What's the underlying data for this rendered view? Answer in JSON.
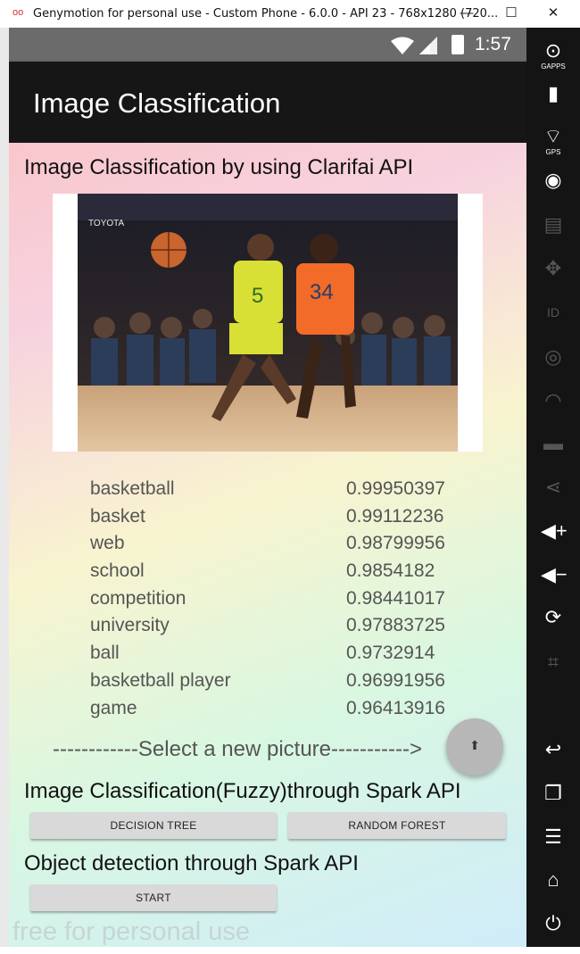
{
  "window": {
    "title": "Genymotion for personal use - Custom Phone - 6.0.0 - API 23 - 768x1280 (720..."
  },
  "status_bar": {
    "time": "1:57"
  },
  "app_bar": {
    "title": "Image Classification"
  },
  "main": {
    "heading": "Image Classification by using Clarifai API",
    "results": [
      {
        "label": "basketball",
        "score": "0.99950397"
      },
      {
        "label": "basket",
        "score": "0.99112236"
      },
      {
        "label": "web",
        "score": "0.98799956"
      },
      {
        "label": "school",
        "score": "0.9854182"
      },
      {
        "label": "competition",
        "score": "0.98441017"
      },
      {
        "label": "university",
        "score": "0.97883725"
      },
      {
        "label": "ball",
        "score": "0.9732914"
      },
      {
        "label": "basketball player",
        "score": "0.96991956"
      },
      {
        "label": "game",
        "score": "0.96413916"
      }
    ],
    "select_text": "------------Select a new picture----------->",
    "fuzzy_heading": "Image Classification(Fuzzy)through Spark API",
    "decision_tree_label": "DECISION TREE",
    "random_forest_label": "RANDOM FOREST",
    "object_heading": "Object detection through Spark API",
    "start_label": "START",
    "watermark": "free for personal use",
    "photo_jersey_left": "5",
    "photo_jersey_right": "34",
    "photo_sponsor": "TOYOTA"
  },
  "sidebar": {
    "gapps_label": "GAPPS",
    "gps_label": "GPS",
    "id_label": "ID"
  },
  "colors": {
    "status_bar": "#6b6b6b",
    "app_bar": "#161616",
    "sidebar": "#141414",
    "fab": "#b7b7b7",
    "button": "#d9d9d9"
  }
}
